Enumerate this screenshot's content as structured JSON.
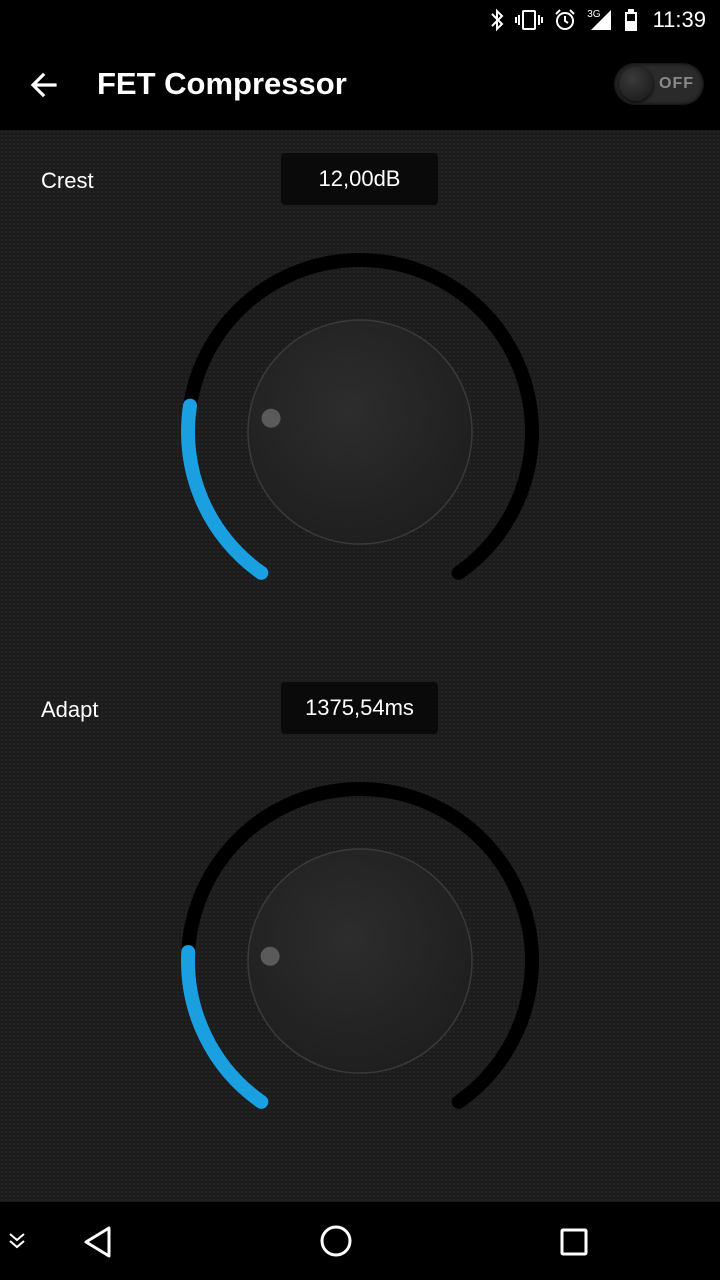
{
  "status_bar": {
    "time": "11:39",
    "network": "3G",
    "icons": [
      "bluetooth-icon",
      "vibrate-icon",
      "alarm-icon",
      "signal-3g-icon",
      "battery-icon"
    ]
  },
  "app_bar": {
    "title": "FET Compressor",
    "toggle_label": "OFF",
    "toggle_on": false,
    "back_icon": "arrow-back-icon"
  },
  "params": [
    {
      "label": "Crest",
      "value": "12,00dB",
      "level": 0.22
    },
    {
      "label": "Adapt",
      "value": "1375,54ms",
      "level": 0.2
    }
  ],
  "colors": {
    "accent": "#1a9fe0",
    "track": "#000000",
    "background": "#1c1c1c"
  },
  "nav_bar": {
    "icons": [
      "collapse-icon",
      "back-triangle-icon",
      "home-circle-icon",
      "recents-square-icon"
    ]
  }
}
